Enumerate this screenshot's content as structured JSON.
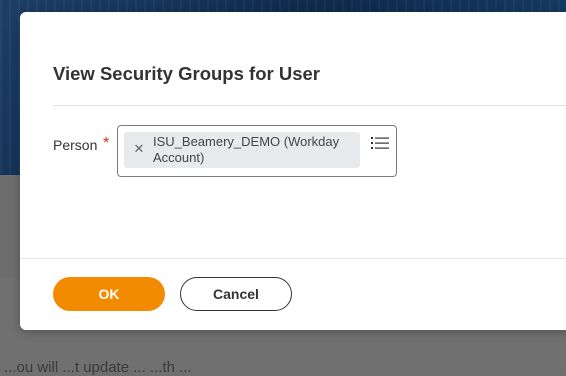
{
  "background": {
    "partial_text": "...ou will ...t update ... ...th ... "
  },
  "dialog": {
    "title": "View Security Groups for User",
    "field": {
      "label": "Person",
      "required_marker": "*",
      "selected_value": "ISU_Beamery_DEMO (Workday Account)",
      "remove_icon": "close-icon",
      "prompt_icon": "list-icon"
    },
    "buttons": {
      "ok_label": "OK",
      "cancel_label": "Cancel"
    }
  },
  "colors": {
    "primary_button": "#f38b00",
    "required": "#de2e21",
    "pill_bg": "#e7e9eb"
  }
}
